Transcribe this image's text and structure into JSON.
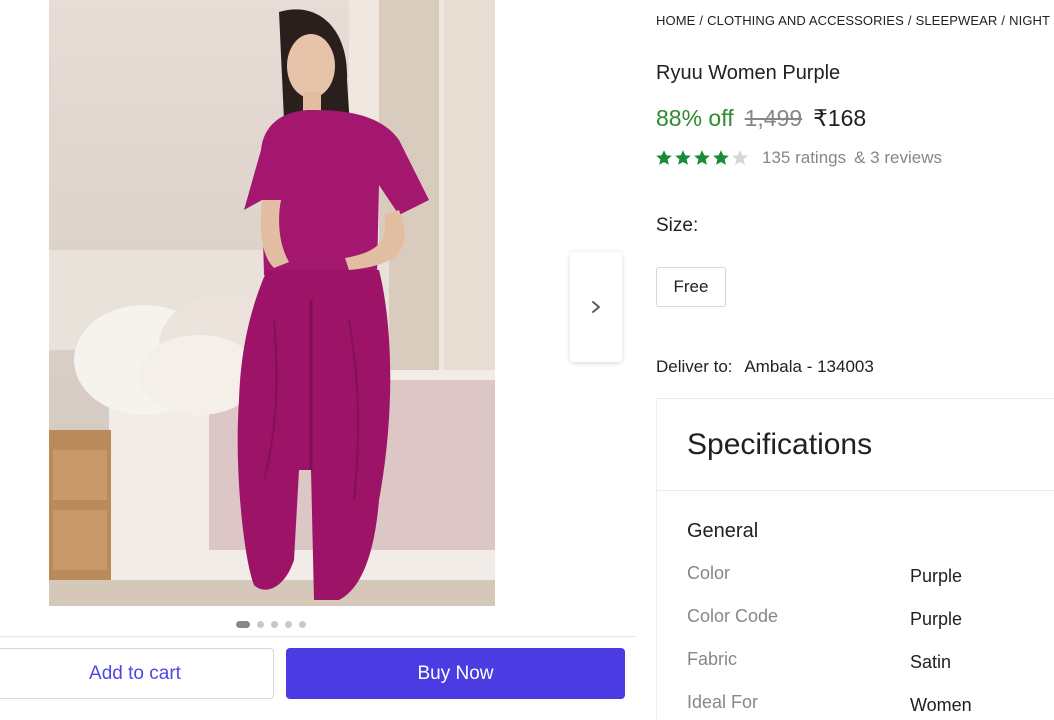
{
  "breadcrumb": [
    "HOME",
    "CLOTHING AND ACCESSORIES",
    "SLEEPWEAR",
    "NIGHT SUITS"
  ],
  "product": {
    "title": "Ryuu Women Purple",
    "discount": "88% off",
    "mrp": "1,499",
    "price": "₹168",
    "rating_stars": 4,
    "ratings": "135 ratings",
    "reviews": "& 3 reviews"
  },
  "gallery": {
    "image_count": 5,
    "active_index": 0,
    "next_icon": "chevron-right-icon"
  },
  "size": {
    "label": "Size:",
    "selected": "Free"
  },
  "delivery": {
    "label": "Deliver to:",
    "location": "Ambala - 134003"
  },
  "actions": {
    "add_to_cart": "Add to cart",
    "buy_now": "Buy Now"
  },
  "specifications": {
    "title": "Specifications",
    "group": "General",
    "rows": [
      {
        "key": "Color",
        "value": "Purple"
      },
      {
        "key": "Color Code",
        "value": "Purple"
      },
      {
        "key": "Fabric",
        "value": "Satin"
      },
      {
        "key": "Ideal For",
        "value": "Women"
      }
    ]
  },
  "colors": {
    "accent": "#4a3be3",
    "discount": "#2e8b2e",
    "star_filled": "#1b8a3a",
    "star_empty": "#d6d6d6"
  }
}
